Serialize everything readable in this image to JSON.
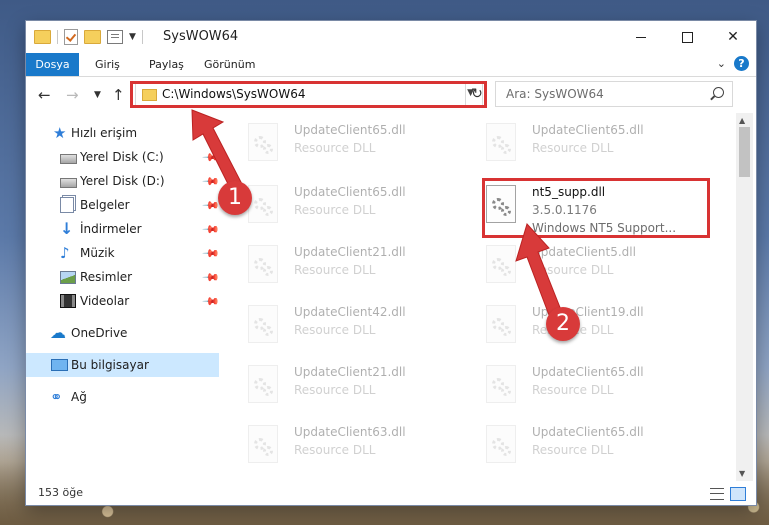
{
  "window": {
    "title": "SysWOW64"
  },
  "ribbon": {
    "tabs": [
      "Dosya",
      "Giriş",
      "Paylaş",
      "Görünüm"
    ],
    "help": "?"
  },
  "address": {
    "path": "C:\\Windows\\SysWOW64",
    "search_placeholder": "Ara: SysWOW64"
  },
  "sidebar": {
    "items": [
      {
        "label": "Hızlı erişim",
        "icon": "star-icon"
      },
      {
        "label": "Yerel Disk (C:)",
        "icon": "drive-icon",
        "pinned": true
      },
      {
        "label": "Yerel Disk (D:)",
        "icon": "drive-icon",
        "pinned": true
      },
      {
        "label": "Belgeler",
        "icon": "documents-icon",
        "pinned": true
      },
      {
        "label": "İndirmeler",
        "icon": "download-icon",
        "pinned": true
      },
      {
        "label": "Müzik",
        "icon": "music-icon",
        "pinned": true
      },
      {
        "label": "Resimler",
        "icon": "pictures-icon",
        "pinned": true
      },
      {
        "label": "Videolar",
        "icon": "videos-icon",
        "pinned": true
      },
      {
        "label": "OneDrive",
        "icon": "cloud-icon"
      },
      {
        "label": "Bu bilgisayar",
        "icon": "computer-icon",
        "selected": true
      },
      {
        "label": "Ağ",
        "icon": "network-icon"
      }
    ]
  },
  "files": {
    "left": [
      {
        "name": "UpdateClient65.dll",
        "desc": "Resource DLL"
      },
      {
        "name": "UpdateClient65.dll",
        "desc": "Resource DLL"
      },
      {
        "name": "UpdateClient21.dll",
        "desc": "Resource DLL"
      },
      {
        "name": "UpdateClient42.dll",
        "desc": "Resource DLL"
      },
      {
        "name": "UpdateClient21.dll",
        "desc": "Resource DLL"
      },
      {
        "name": "UpdateClient63.dll",
        "desc": "Resource DLL"
      }
    ],
    "right": [
      {
        "name": "UpdateClient65.dll",
        "desc": "Resource DLL"
      },
      {
        "name": "nt5_supp.dll",
        "version": "3.5.0.1176",
        "desc": "Windows NT5 Support...",
        "highlighted": true
      },
      {
        "name": "UpdateClient5.dll",
        "desc": "Resource DLL"
      },
      {
        "name": "UpdateClient19.dll",
        "desc": "Resource DLL"
      },
      {
        "name": "UpdateClient65.dll",
        "desc": "Resource DLL"
      },
      {
        "name": "UpdateClient65.dll",
        "desc": "Resource DLL"
      }
    ]
  },
  "status": {
    "count": "153 öğe"
  },
  "annotations": {
    "badge1": "1",
    "badge2": "2",
    "color": "#d83333"
  }
}
